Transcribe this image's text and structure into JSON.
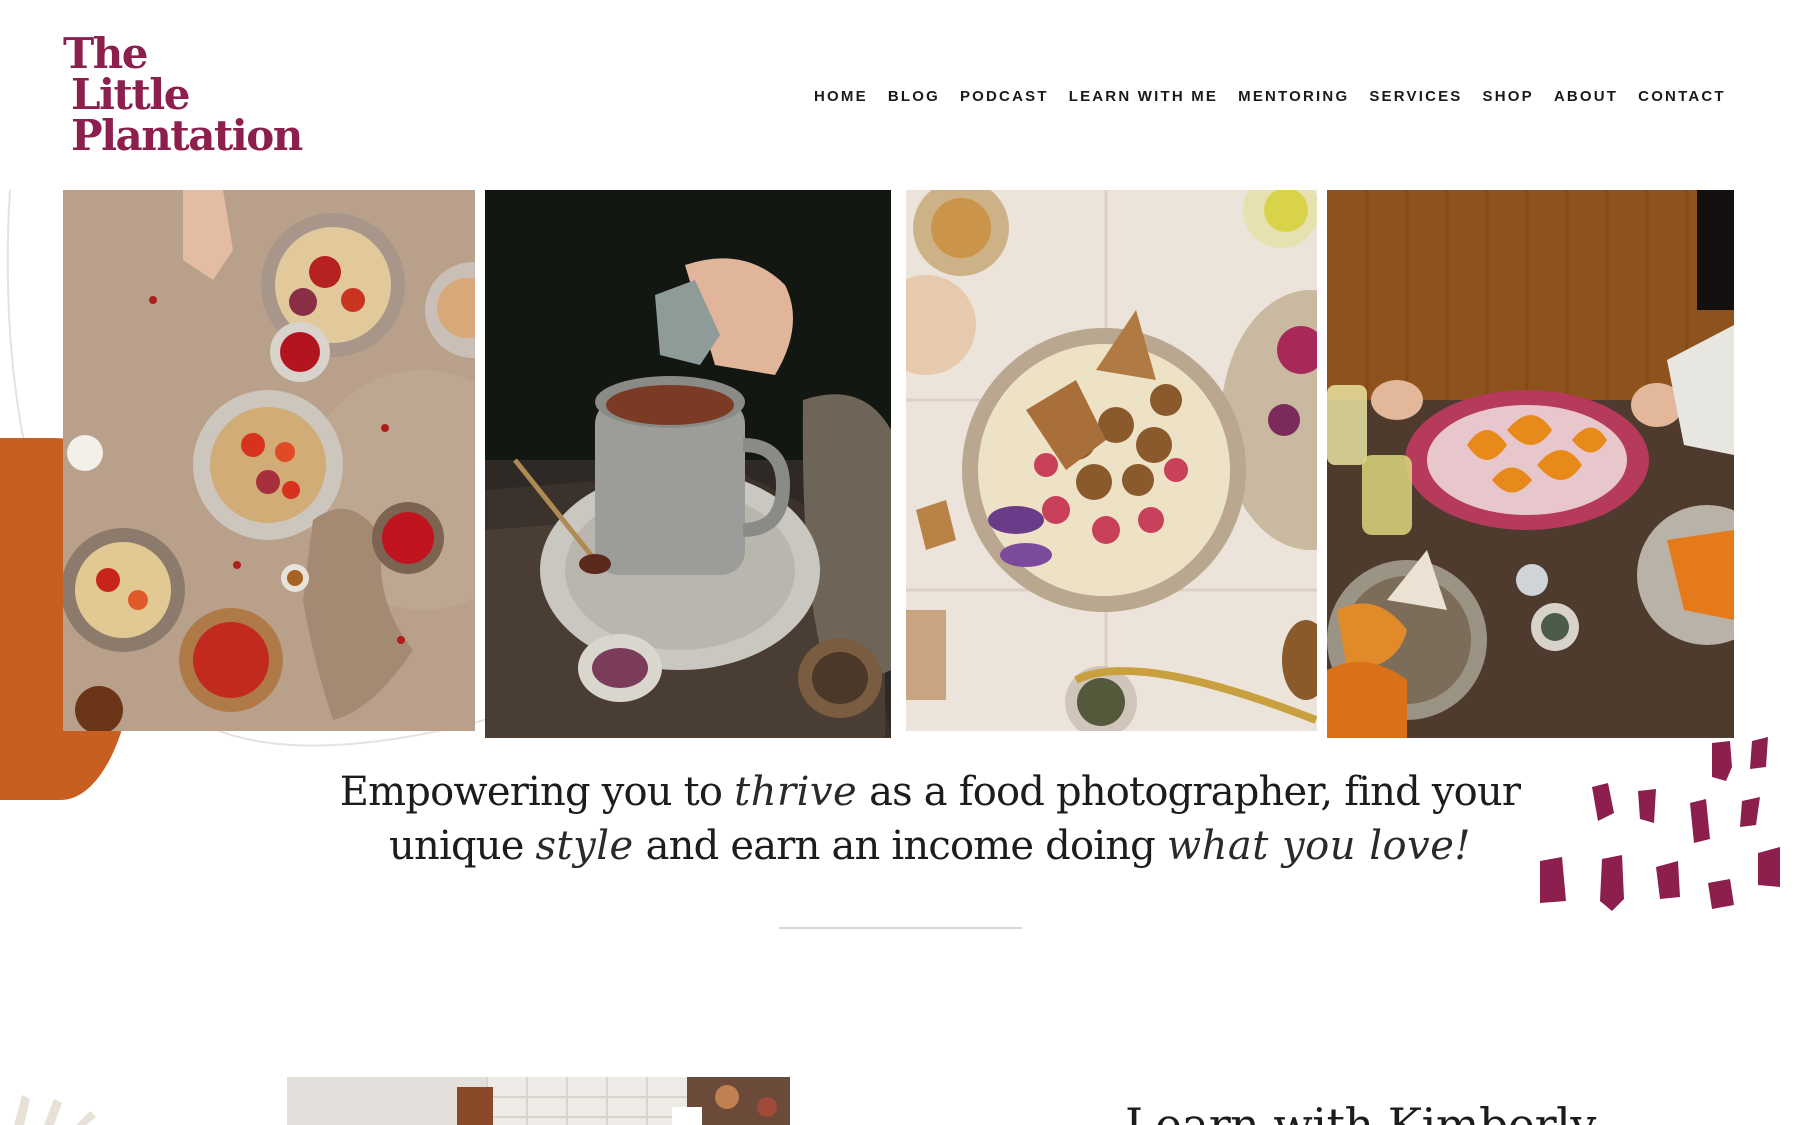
{
  "brand": {
    "logo_line1": "The",
    "logo_line2": "Little",
    "logo_line3": "Plantation",
    "color": "#8c1f4d"
  },
  "nav": {
    "items": [
      "HOME",
      "BLOG",
      "PODCAST",
      "LEARN WITH ME",
      "MENTORING",
      "SERVICES",
      "SHOP",
      "ABOUT",
      "CONTACT"
    ]
  },
  "gallery": {
    "photos": [
      {
        "name": "pancakes-berries-photo"
      },
      {
        "name": "hot-chocolate-photo"
      },
      {
        "name": "meatball-bowl-photo"
      },
      {
        "name": "tortellini-plate-photo"
      }
    ]
  },
  "hero": {
    "part1": "Empowering you to ",
    "script1": "thrive",
    "part2": " as a food photographer,  find your",
    "part3": "unique ",
    "script2": "style",
    "part4": " and earn an income doing ",
    "script3": "what you love!"
  },
  "learn": {
    "heading": "Learn with Kimberly"
  },
  "colors": {
    "accent_plum": "#8c1f4d",
    "accent_orange": "#c85e1f",
    "text": "#1c1c1c"
  }
}
